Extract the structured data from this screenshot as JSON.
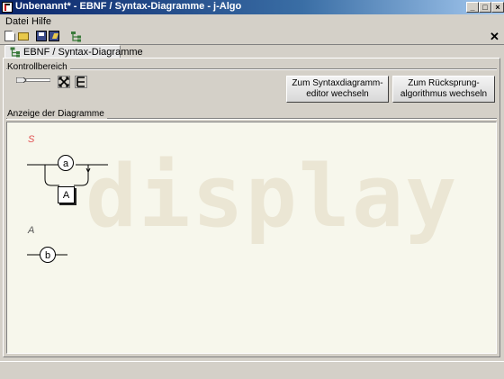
{
  "window": {
    "title": "Unbenannt*  -  EBNF / Syntax-Diagramme  -  j-Algo"
  },
  "menu": {
    "items": [
      "Datei",
      "Hilfe"
    ]
  },
  "tab": {
    "label": "EBNF / Syntax-Diagramme"
  },
  "control": {
    "section_label": "Kontrollbereich",
    "editor_button": {
      "line1": "Zum Syntaxdiagramm-",
      "line2": "editor wechseln"
    },
    "backtrack_button": {
      "line1": "Zum Rücksprung-",
      "line2": "algorithmus wechseln"
    }
  },
  "display": {
    "section_label": "Anzeige der Diagramme",
    "watermark": "display",
    "rules": [
      {
        "name": "S",
        "color": "#e05050",
        "terminal": "a",
        "variable": "A"
      },
      {
        "name": "A",
        "color": "#555555",
        "terminal": "b"
      }
    ]
  },
  "colors": {
    "title_start": "#0a246a",
    "title_end": "#a6caf0",
    "display_bg": "#f7f7ec"
  }
}
